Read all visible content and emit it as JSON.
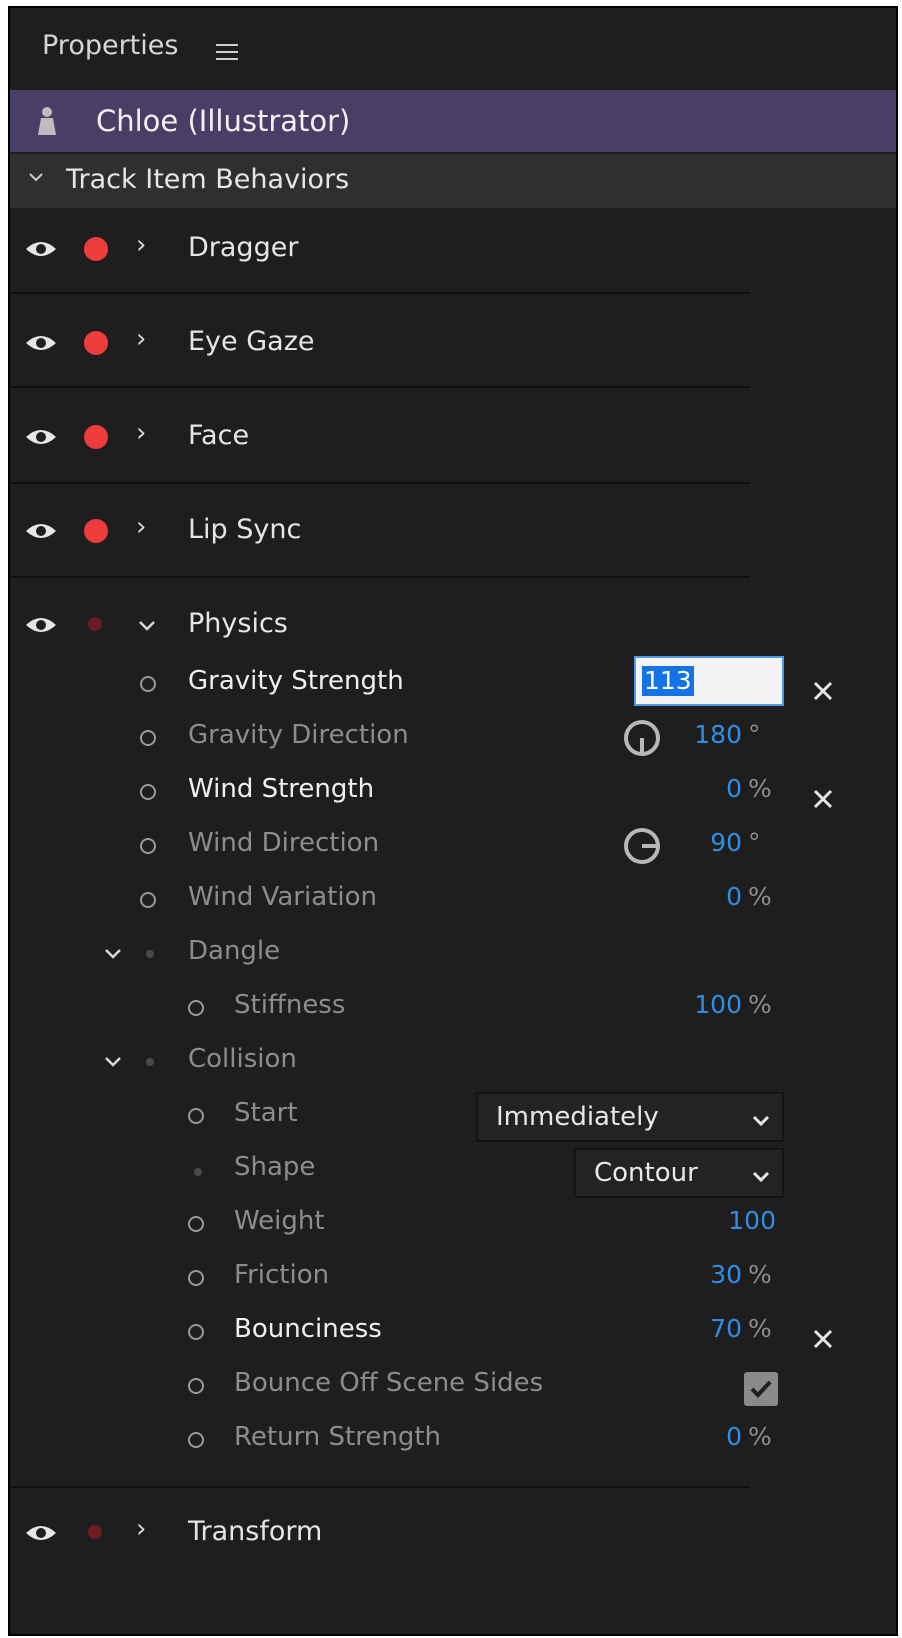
{
  "panel": {
    "title": "Properties",
    "menu_icon": "hamburger-icon"
  },
  "puppet": {
    "name": "Chloe (Illustrator)",
    "icon": "puppet-icon"
  },
  "section": {
    "label": "Track Item Behaviors"
  },
  "behaviors": [
    {
      "label": "Dragger"
    },
    {
      "label": "Eye Gaze"
    },
    {
      "label": "Face"
    },
    {
      "label": "Lip Sync"
    },
    {
      "label": "Physics"
    },
    {
      "label": "Transform"
    }
  ],
  "physics": {
    "gravity_strength": {
      "label": "Gravity Strength",
      "value": "113"
    },
    "gravity_direction": {
      "label": "Gravity Direction",
      "value": "180",
      "unit": "°"
    },
    "wind_strength": {
      "label": "Wind Strength",
      "value": "0",
      "unit": "%"
    },
    "wind_direction": {
      "label": "Wind Direction",
      "value": "90",
      "unit": "°"
    },
    "wind_variation": {
      "label": "Wind Variation",
      "value": "0",
      "unit": "%"
    },
    "dangle": {
      "label": "Dangle",
      "stiffness": {
        "label": "Stiffness",
        "value": "100",
        "unit": "%"
      }
    },
    "collision": {
      "label": "Collision",
      "start": {
        "label": "Start",
        "value": "Immediately"
      },
      "shape": {
        "label": "Shape",
        "value": "Contour"
      },
      "weight": {
        "label": "Weight",
        "value": "100"
      },
      "friction": {
        "label": "Friction",
        "value": "30",
        "unit": "%"
      },
      "bounciness": {
        "label": "Bounciness",
        "value": "70",
        "unit": "%"
      },
      "bounce_off_scene_sides": {
        "label": "Bounce Off Scene Sides",
        "checked": true
      },
      "return_strength": {
        "label": "Return Strength",
        "value": "0",
        "unit": "%"
      }
    }
  },
  "colors": {
    "accent": "#2f8ee6",
    "puppet_bar": "#4a3e66",
    "armed_dot": "#ee3b3b",
    "panel_bg": "#1e1e1e"
  }
}
